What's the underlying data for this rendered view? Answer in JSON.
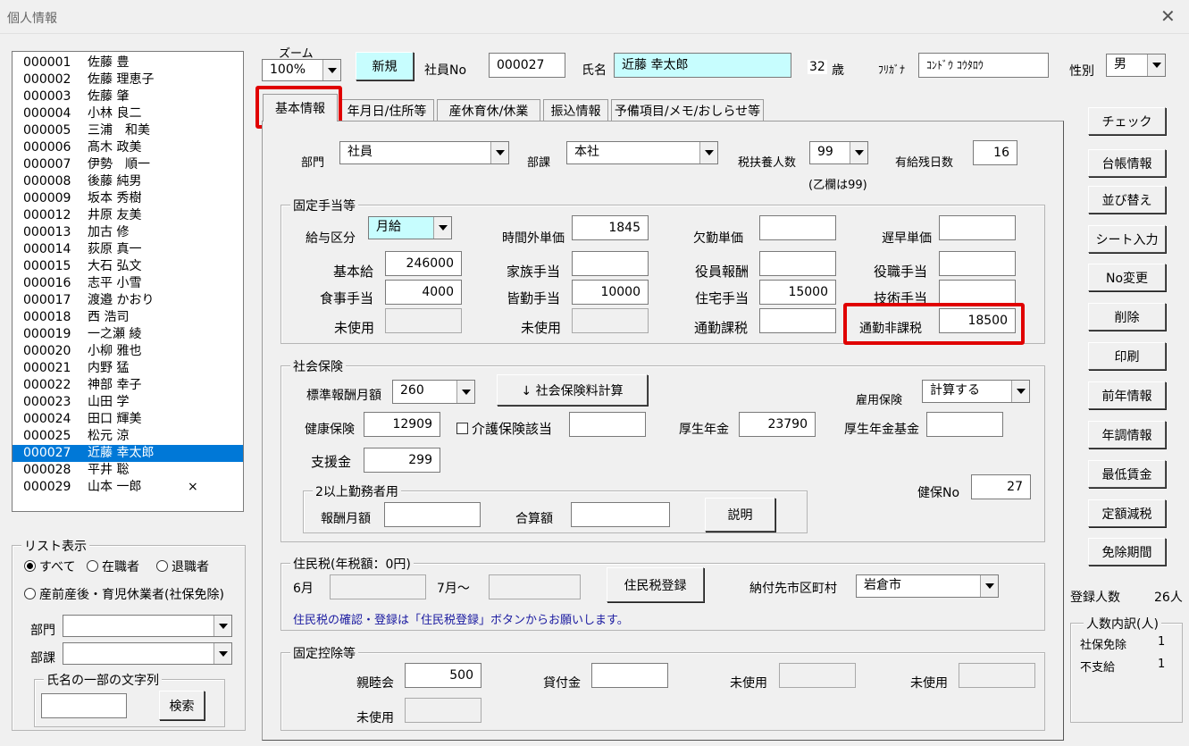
{
  "window": {
    "title": "個人情報"
  },
  "employees": [
    {
      "no": "000001",
      "name": "佐藤 豊",
      "mark": ""
    },
    {
      "no": "000002",
      "name": "佐藤 理恵子",
      "mark": ""
    },
    {
      "no": "000003",
      "name": "佐藤 肇",
      "mark": ""
    },
    {
      "no": "000004",
      "name": "小林 良二",
      "mark": ""
    },
    {
      "no": "000005",
      "name": "三浦　和美",
      "mark": ""
    },
    {
      "no": "000006",
      "name": "髙木 政美",
      "mark": ""
    },
    {
      "no": "000007",
      "name": "伊勢　順一",
      "mark": ""
    },
    {
      "no": "000008",
      "name": "後藤 純男",
      "mark": ""
    },
    {
      "no": "000009",
      "name": "坂本 秀樹",
      "mark": ""
    },
    {
      "no": "000012",
      "name": "井原 友美",
      "mark": ""
    },
    {
      "no": "000013",
      "name": "加古 修",
      "mark": ""
    },
    {
      "no": "000014",
      "name": "荻原 真一",
      "mark": ""
    },
    {
      "no": "000015",
      "name": "大石 弘文",
      "mark": ""
    },
    {
      "no": "000016",
      "name": "志平 小雪",
      "mark": ""
    },
    {
      "no": "000017",
      "name": "渡邉 かおり",
      "mark": ""
    },
    {
      "no": "000018",
      "name": "西 浩司",
      "mark": ""
    },
    {
      "no": "000019",
      "name": "一之瀬 綾",
      "mark": ""
    },
    {
      "no": "000020",
      "name": "小柳 雅也",
      "mark": ""
    },
    {
      "no": "000021",
      "name": "内野 猛",
      "mark": ""
    },
    {
      "no": "000022",
      "name": "神部 幸子",
      "mark": ""
    },
    {
      "no": "000023",
      "name": "山田 学",
      "mark": ""
    },
    {
      "no": "000024",
      "name": "田口 輝美",
      "mark": ""
    },
    {
      "no": "000025",
      "name": "松元 涼",
      "mark": ""
    },
    {
      "no": "000027",
      "name": "近藤 幸太郎",
      "mark": "",
      "selected": true
    },
    {
      "no": "000028",
      "name": "平井 聡",
      "mark": ""
    },
    {
      "no": "000029",
      "name": "山本 一郎",
      "mark": "×"
    }
  ],
  "list_display": {
    "caption": "リスト表示",
    "opt_all": "すべて",
    "opt_active": "在職者",
    "opt_retired": "退職者",
    "opt_leave": "産前産後・育児休業者(社保免除)",
    "dept_label": "部門",
    "section_label": "部課",
    "name_search_caption": "氏名の一部の文字列",
    "search_button": "検索"
  },
  "header": {
    "zoom_label": "ズーム",
    "zoom_value": "100%",
    "new_button": "新規",
    "emp_no_label": "社員No",
    "emp_no": "000027",
    "name_label": "氏名",
    "name": "近藤 幸太郎",
    "age": "32",
    "age_unit": "歳",
    "furigana_label": "ﾌﾘｶﾞﾅ",
    "furigana": "ｺﾝﾄﾞｳ ｺｳﾀﾛｳ",
    "gender_label": "性別",
    "gender": "男"
  },
  "tabs": [
    "基本情報",
    "年月日/住所等",
    "産休育休/休業",
    "振込情報",
    "予備項目/メモ/おしらせ等"
  ],
  "basic": {
    "dept_label": "部門",
    "dept": "社員",
    "section_label": "部課",
    "section": "本社",
    "dependents_label": "税扶養人数",
    "dependents": "99",
    "dependents_note": "(乙欄は99)",
    "paid_leave_label": "有給残日数",
    "paid_leave": "16"
  },
  "fixed_allowance": {
    "caption": "固定手当等",
    "pay_type_label": "給与区分",
    "pay_type": "月給",
    "overtime_rate_label": "時間外単価",
    "overtime_rate": "1845",
    "absence_rate_label": "欠勤単価",
    "absence_rate": "",
    "late_rate_label": "遅早単価",
    "late_rate": "",
    "base_pay_label": "基本給",
    "base_pay": "246000",
    "family_label": "家族手当",
    "family": "",
    "officer_label": "役員報酬",
    "officer": "",
    "position_label": "役職手当",
    "position": "",
    "meal_label": "食事手当",
    "meal": "4000",
    "attendance_label": "皆勤手当",
    "attendance": "10000",
    "housing_label": "住宅手当",
    "housing": "15000",
    "skill_label": "技術手当",
    "skill": "",
    "unused1_label": "未使用",
    "unused2_label": "未使用",
    "commute_taxable_label": "通勤課税",
    "commute_taxable": "",
    "commute_nontaxable_label": "通勤非課税",
    "commute_nontaxable": "18500"
  },
  "social_insurance": {
    "caption": "社会保険",
    "std_monthly_label": "標準報酬月額",
    "std_monthly": "260",
    "calc_button": "↓ 社会保険料計算",
    "employment_label": "雇用保険",
    "employment": "計算する",
    "health_label": "健康保険",
    "health": "12909",
    "care_label": "介護保険該当",
    "pension_label": "厚生年金",
    "pension": "23790",
    "pension_fund_label": "厚生年金基金",
    "pension_fund": "",
    "support_label": "支援金",
    "support": "299",
    "multi_caption": "2以上勤務者用",
    "multi_monthly_label": "報酬月額",
    "multi_total_label": "合算額",
    "explain_button": "説明",
    "health_no_label": "健保No",
    "health_no": "27"
  },
  "resident_tax": {
    "caption": "住民税(年税額：0円)",
    "june_label": "6月",
    "july_label": "7月～",
    "register_button": "住民税登録",
    "city_label": "納付先市区町村",
    "city": "岩倉市",
    "note": "住民税の確認・登録は「住民税登録」ボタンからお願いします。"
  },
  "fixed_deduction": {
    "caption": "固定控除等",
    "social_club_label": "親睦会",
    "social_club": "500",
    "loan_label": "貸付金",
    "loan": "",
    "unused_a_label": "未使用",
    "unused_b_label": "未使用",
    "unused_c_label": "未使用"
  },
  "side_buttons": [
    "チェック",
    "台帳情報",
    "並び替え",
    "シート入力",
    "No変更",
    "削除",
    "印刷",
    "前年情報",
    "年調情報",
    "最低賃金",
    "定額減税",
    "免除期間"
  ],
  "summary": {
    "count_label": "登録人数",
    "count": "26人",
    "breakdown_caption": "人数内訳(人)",
    "exempt_label": "社保免除",
    "exempt": "1",
    "unpaid_label": "不支給",
    "unpaid": "1"
  },
  "colors": {
    "accent_cyan": "#c7fdfe",
    "selection": "#0078d7",
    "highlight_red": "#e00000"
  }
}
